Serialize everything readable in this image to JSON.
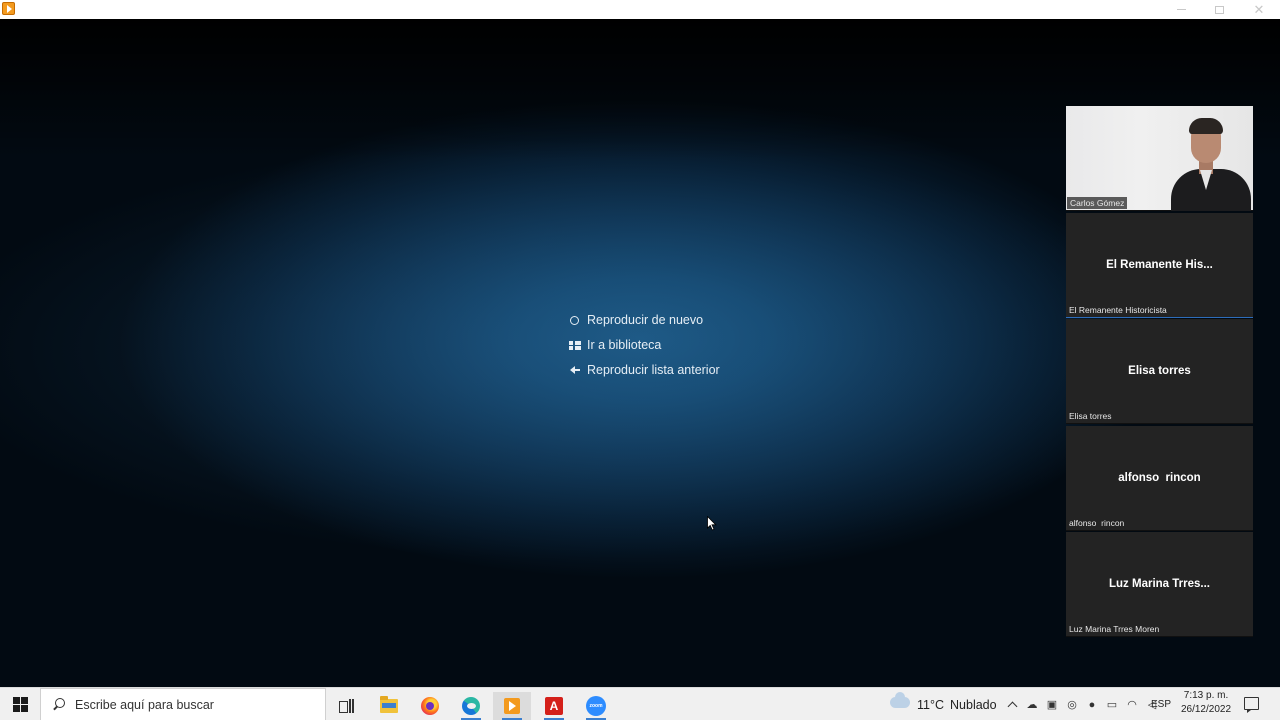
{
  "window": {
    "app_icon": "vlc-cone-icon",
    "controls": [
      "minimize",
      "maximize",
      "close"
    ]
  },
  "player": {
    "menu": [
      {
        "icon": "replay-icon",
        "label": "Reproducir de nuevo"
      },
      {
        "icon": "library-icon",
        "label": "Ir a biblioteca"
      },
      {
        "icon": "back-arrow-icon",
        "label": "Reproducir lista anterior"
      }
    ]
  },
  "participants": [
    {
      "center_name": "",
      "tag": "Carlos Gómez",
      "video": true
    },
    {
      "center_name": "El Remanente His...",
      "tag": "El Remanente Historicista",
      "video": false
    },
    {
      "center_name": "Elisa torres",
      "tag": "Elisa torres",
      "video": false
    },
    {
      "center_name": "alfonso  rincon",
      "tag": "alfonso  rincon",
      "video": false
    },
    {
      "center_name": "Luz Marina Trres...",
      "tag": "Luz Marina Trres Moren",
      "video": false
    }
  ],
  "taskbar": {
    "search_placeholder": "Escribe aquí para buscar",
    "apps": [
      "task-view",
      "file-explorer",
      "firefox",
      "edge",
      "vlc",
      "acrobat",
      "zoom"
    ],
    "zoom_label": "zoom",
    "acrobat_label": "A",
    "weather": {
      "temp": "11°C",
      "condition": "Nublado"
    },
    "language": "ESP",
    "time": "7:13 p. m.",
    "date": "26/12/2022"
  },
  "colors": {
    "accent": "#2d6dbb",
    "player_glow": "#1c5a86",
    "tile_bg": "#232323"
  }
}
